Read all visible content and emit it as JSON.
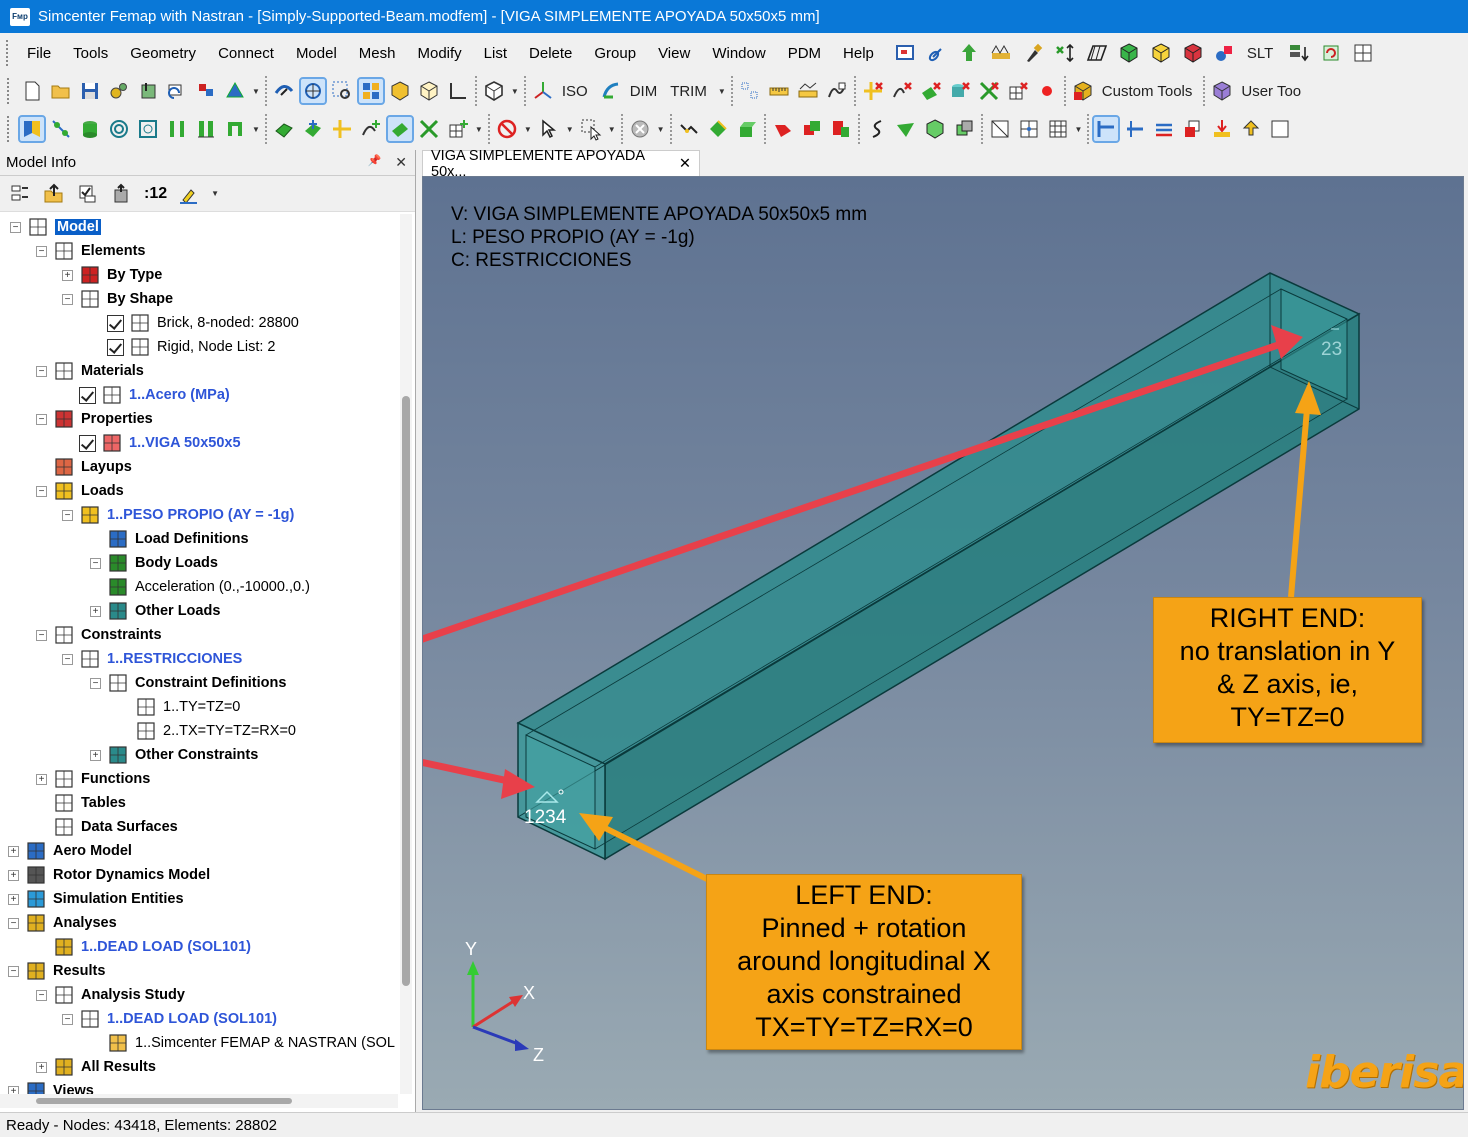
{
  "window": {
    "title": "Simcenter Femap with Nastran - [Simply-Supported-Beam.modfem] - [VIGA SIMPLEMENTE APOYADA 50x50x5 mm]",
    "icon_text": "Fмp"
  },
  "menu": [
    "File",
    "Tools",
    "Geometry",
    "Connect",
    "Model",
    "Mesh",
    "Modify",
    "List",
    "Delete",
    "Group",
    "View",
    "Window",
    "PDM",
    "Help"
  ],
  "menu_right": {
    "slt": "SLT"
  },
  "toolbar1": {
    "iso": "ISO",
    "dim": "DIM",
    "trim": "TRIM",
    "custom_tools": "Custom Tools",
    "user_tools": "User Too"
  },
  "panel": {
    "title": "Model Info",
    "pin": "📌",
    "close": "✕",
    "toolbar_count": ":12"
  },
  "tree": [
    {
      "label": "Model",
      "style": "sel",
      "exp": "−",
      "icon": "model-icon"
    },
    {
      "label": "Elements",
      "style": "bold",
      "exp": "−",
      "icon": "elements-icon"
    },
    {
      "label": "By Type",
      "style": "bold",
      "exp": "+",
      "icon": "by-type-icon"
    },
    {
      "label": "By Shape",
      "style": "bold",
      "exp": "−",
      "icon": "by-shape-icon"
    },
    {
      "label": "Brick, 8-noded: 28800",
      "style": "plain",
      "check": true,
      "icon": "brick-icon"
    },
    {
      "label": "Rigid, Node List: 2",
      "style": "plain",
      "check": true,
      "icon": "rigid-icon"
    },
    {
      "label": "Materials",
      "style": "bold",
      "exp": "−",
      "icon": "materials-icon"
    },
    {
      "label": "1..Acero (MPa)",
      "style": "blue",
      "check": true,
      "icon": "material-item-icon"
    },
    {
      "label": "Properties",
      "style": "bold",
      "exp": "−",
      "icon": "properties-icon"
    },
    {
      "label": "1..VIGA 50x50x5",
      "style": "blue",
      "check": true,
      "icon": "property-item-icon"
    },
    {
      "label": "Layups",
      "style": "bold",
      "icon": "layups-icon"
    },
    {
      "label": "Loads",
      "style": "bold",
      "exp": "−",
      "icon": "loads-icon"
    },
    {
      "label": "1..PESO PROPIO (AY = -1g)",
      "style": "blue",
      "exp": "−",
      "icon": "load-set-icon"
    },
    {
      "label": "Load Definitions",
      "style": "bold",
      "icon": "load-definitions-icon"
    },
    {
      "label": "Body Loads",
      "style": "bold",
      "exp": "−",
      "icon": "body-loads-icon"
    },
    {
      "label": "Acceleration (0.,-10000.,0.)",
      "style": "plain",
      "icon": "acceleration-icon"
    },
    {
      "label": "Other Loads",
      "style": "bold",
      "exp": "+",
      "icon": "other-loads-icon"
    },
    {
      "label": "Constraints",
      "style": "bold",
      "exp": "−",
      "icon": "constraints-icon"
    },
    {
      "label": "1..RESTRICCIONES",
      "style": "blue",
      "exp": "−",
      "icon": "constraint-set-icon"
    },
    {
      "label": "Constraint Definitions",
      "style": "bold",
      "exp": "−",
      "icon": "constraint-definitions-icon"
    },
    {
      "label": "1..TY=TZ=0",
      "style": "plain",
      "icon": "constraint-def-icon"
    },
    {
      "label": "2..TX=TY=TZ=RX=0",
      "style": "plain",
      "icon": "constraint-def-icon"
    },
    {
      "label": "Other Constraints",
      "style": "bold",
      "exp": "+",
      "icon": "other-constraints-icon"
    },
    {
      "label": "Functions",
      "style": "bold",
      "exp": "+",
      "icon": "functions-icon"
    },
    {
      "label": "Tables",
      "style": "bold",
      "icon": "tables-icon"
    },
    {
      "label": "Data Surfaces",
      "style": "bold",
      "icon": "data-surfaces-icon"
    },
    {
      "label": "Aero Model",
      "style": "bold",
      "exp": "+",
      "icon": "aero-model-icon"
    },
    {
      "label": "Rotor Dynamics Model",
      "style": "bold",
      "exp": "+",
      "icon": "rotor-dynamics-icon"
    },
    {
      "label": "Simulation Entities",
      "style": "bold",
      "exp": "+",
      "icon": "simulation-entities-icon"
    },
    {
      "label": "Analyses",
      "style": "bold",
      "exp": "−",
      "icon": "analyses-icon"
    },
    {
      "label": "1..DEAD LOAD (SOL101)",
      "style": "blue",
      "icon": "analysis-item-icon"
    },
    {
      "label": "Results",
      "style": "bold",
      "exp": "−",
      "icon": "results-icon"
    },
    {
      "label": "Analysis Study",
      "style": "bold",
      "exp": "−",
      "icon": "analysis-study-icon"
    },
    {
      "label": "1..DEAD LOAD (SOL101)",
      "style": "blue",
      "exp": "−",
      "icon": "study-item-icon"
    },
    {
      "label": "1..Simcenter FEMAP & NASTRAN (SOL",
      "style": "plain",
      "icon": "result-folder-icon"
    },
    {
      "label": "All Results",
      "style": "bold",
      "exp": "+",
      "icon": "all-results-icon"
    },
    {
      "label": "Views",
      "style": "bold",
      "exp": "+",
      "icon": "views-icon"
    }
  ],
  "tab": {
    "label": "VIGA SIMPLEMENTE APOYADA 50x...",
    "close": "✕"
  },
  "viewport": {
    "info_v": "V: VIGA SIMPLEMENTE APOYADA 50x50x5 mm",
    "info_l": "L: PESO PROPIO (AY = -1g)",
    "info_c": "C: RESTRICCIONES",
    "label_right": "23",
    "label_left": "1234",
    "axis_x": "X",
    "axis_y": "Y",
    "axis_z": "Z",
    "watermark": "iberisa",
    "colors": {
      "beam": "#2e8a8c",
      "arrow": "#e8404a",
      "callout": "#f5a316"
    }
  },
  "callouts": {
    "right": [
      "RIGHT END:",
      "no translation in Y",
      "& Z axis, ie,",
      "TY=TZ=0"
    ],
    "left": [
      "LEFT END:",
      "Pinned + rotation",
      "around longitudinal X",
      "axis constrained",
      "TX=TY=TZ=RX=0"
    ]
  },
  "status": "Ready - Nodes: 43418,  Elements: 28802"
}
